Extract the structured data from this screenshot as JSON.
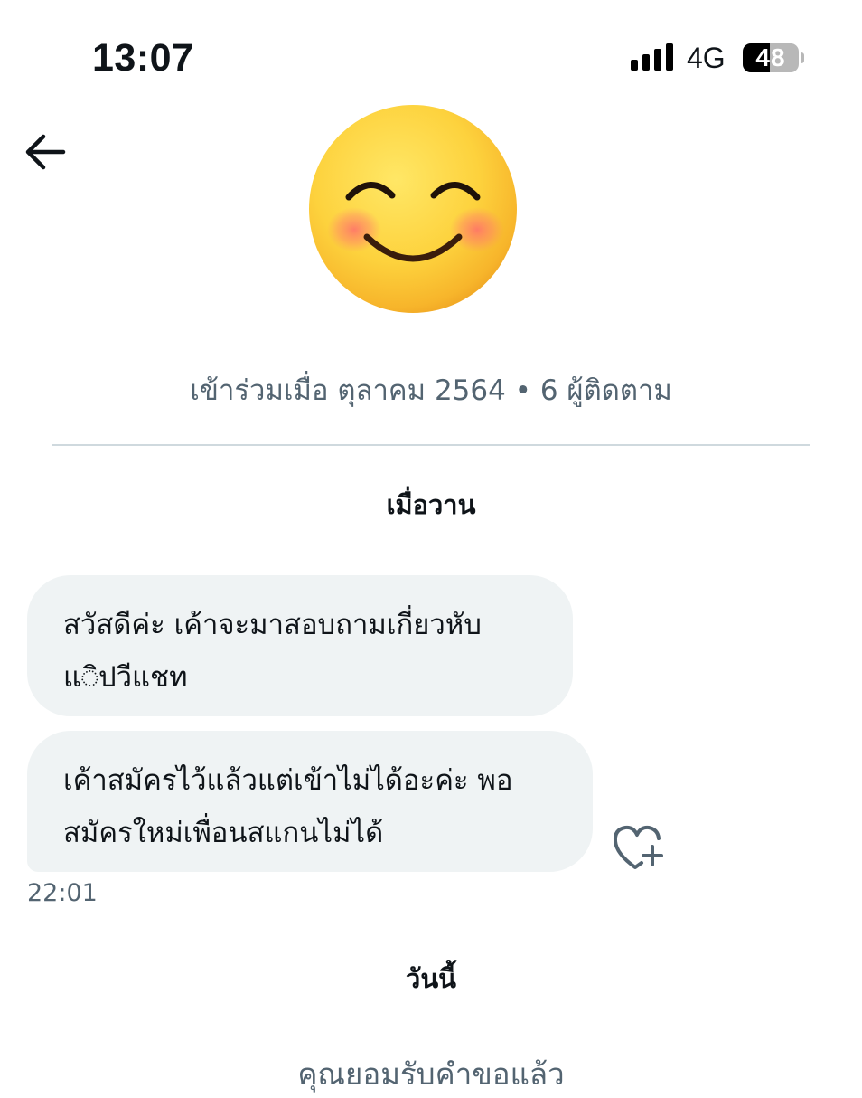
{
  "status_bar": {
    "time": "13:07",
    "network": "4G",
    "battery_percent": "48",
    "battery_level": 0.48,
    "signal_icon": "cellular-signal-icon"
  },
  "header": {
    "back_icon": "arrow-left-icon",
    "avatar_icon": "smiling-face-with-smiling-eyes-emoji"
  },
  "profile": {
    "join_info": "เข้าร่วมเมื่อ ตุลาคม 2564 • 6 ผู้ติดตาม"
  },
  "conversation": {
    "yesterday_label": "เมื่อวาน",
    "messages": [
      {
        "lines": [
          "สวัสดีค่ะ เค้าจะมาสอบถามเกี่ยวหับ",
          "แ◌ิปวีแชท"
        ]
      },
      {
        "lines": [
          "เค้าสมัครไว้แล้วแต่เข้าไม่ได้อะค่ะ พอ",
          "สมัครใหม่เพื่อนสแกนไม่ได้"
        ]
      }
    ],
    "last_message_time": "22:01",
    "react_icon": "heart-plus-icon",
    "today_label": "วันนี้",
    "request_accepted": "คุณยอมรับคำขอแล้ว"
  }
}
